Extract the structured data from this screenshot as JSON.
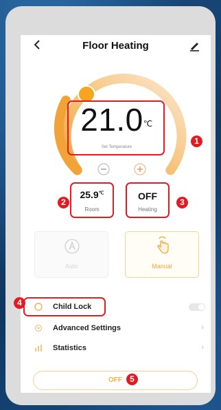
{
  "app": {
    "title": "Floor Heating"
  },
  "setpoint": {
    "value": "21.0",
    "unit": "℃",
    "label": "Set Temperature"
  },
  "room": {
    "value": "25.9",
    "unit": "℃",
    "label": "Room"
  },
  "heating": {
    "value": "OFF",
    "label": "Heating"
  },
  "modes": [
    {
      "label": "Auto",
      "icon": "auto-a-icon",
      "selected": false
    },
    {
      "label": "Manual",
      "icon": "hand-pointer-icon",
      "selected": true
    }
  ],
  "settings": [
    {
      "label": "Child Lock",
      "icon": "lock-icon",
      "control": "toggle",
      "toggle_on": false
    },
    {
      "label": "Advanced Settings",
      "icon": "gear-icon",
      "control": "chevron"
    },
    {
      "label": "Statistics",
      "icon": "bar-chart-icon",
      "control": "chevron"
    }
  ],
  "power_button": {
    "label": "OFF"
  },
  "callouts": [
    "1",
    "2",
    "3",
    "4",
    "5"
  ],
  "colors": {
    "accent": "#f0a93a",
    "accent_light": "#f7d9a6",
    "callout_red": "#e21b23",
    "background_blue": "#123a63"
  }
}
